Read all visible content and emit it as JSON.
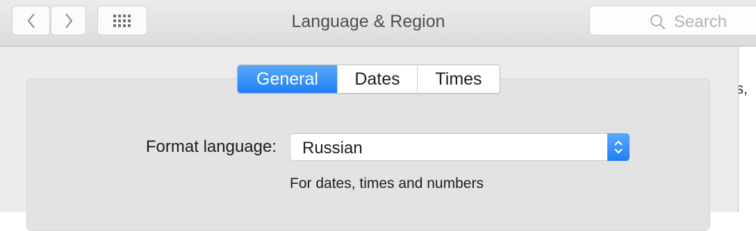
{
  "window": {
    "title": "Language & Region"
  },
  "toolbar": {
    "back_icon": "chevron-left-icon",
    "forward_icon": "chevron-right-icon",
    "grid_icon": "grid-icon",
    "search_placeholder": "Search",
    "search_icon": "magnifier-icon"
  },
  "tabs": [
    {
      "label": "General",
      "active": true
    },
    {
      "label": "Dates",
      "active": false
    },
    {
      "label": "Times",
      "active": false
    }
  ],
  "format": {
    "label": "Format language:",
    "value": "Russian",
    "help": "For dates, times and numbers"
  },
  "rightbar": {
    "text": "s,"
  },
  "colors": {
    "accent": "#1f7ef5",
    "toolbar": "#dcdcdc",
    "panel": "#e3e3e3"
  }
}
